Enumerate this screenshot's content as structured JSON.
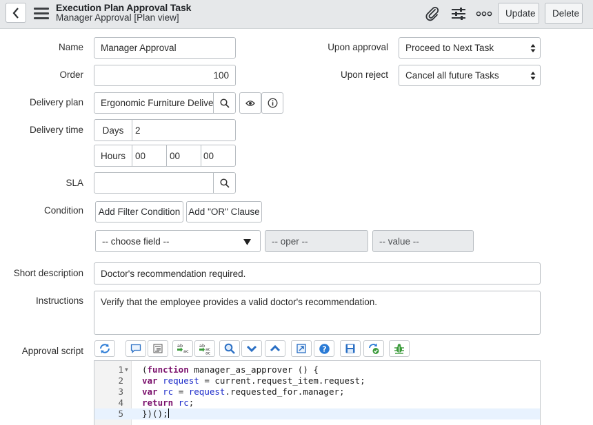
{
  "header": {
    "title": "Execution Plan Approval Task",
    "subtitle": "Manager Approval [Plan view]",
    "update_label": "Update",
    "delete_label": "Delete",
    "icons": [
      "back-icon",
      "menu-icon",
      "paperclip-icon",
      "settings-sliders-icon",
      "more-icon"
    ]
  },
  "form": {
    "name": {
      "label": "Name",
      "value": "Manager Approval"
    },
    "order": {
      "label": "Order",
      "value": "100"
    },
    "delivery_plan": {
      "label": "Delivery plan",
      "value": "Ergonomic Furniture Delivery"
    },
    "delivery_time": {
      "label": "Delivery time",
      "days_label": "Days",
      "days_value": "2",
      "hours_label": "Hours",
      "hours_value": "00",
      "minutes_value": "00",
      "seconds_value": "00"
    },
    "sla": {
      "label": "SLA",
      "value": ""
    },
    "condition": {
      "label": "Condition",
      "add_filter_label": "Add Filter Condition",
      "add_or_label": "Add \"OR\" Clause",
      "field_placeholder": "-- choose field --",
      "oper_placeholder": "-- oper --",
      "value_placeholder": "-- value --"
    },
    "upon_approval": {
      "label": "Upon approval",
      "value": "Proceed to Next Task"
    },
    "upon_reject": {
      "label": "Upon reject",
      "value": "Cancel all future Tasks"
    },
    "short_description": {
      "label": "Short description",
      "value": "Doctor's recommendation required."
    },
    "instructions": {
      "label": "Instructions",
      "value": "Verify that the employee provides a valid doctor's recommendation."
    },
    "approval_script": {
      "label": "Approval script",
      "toolbar_icons": [
        "script-toggle-icon",
        "comment-icon",
        "format-icon",
        "replace-icon",
        "replace-all-icon",
        "search-icon",
        "find-next-icon",
        "find-previous-icon",
        "fullscreen-icon",
        "help-icon",
        "save-icon",
        "script-check-icon",
        "debug-icon"
      ],
      "line_numbers": [
        "1",
        "2",
        "3",
        "4",
        "5"
      ],
      "lines": [
        "(function manager_as_approver () {",
        "var request = current.request_item.request;",
        "var rc = request.requested_for.manager;",
        "return rc;",
        "})();"
      ]
    }
  }
}
